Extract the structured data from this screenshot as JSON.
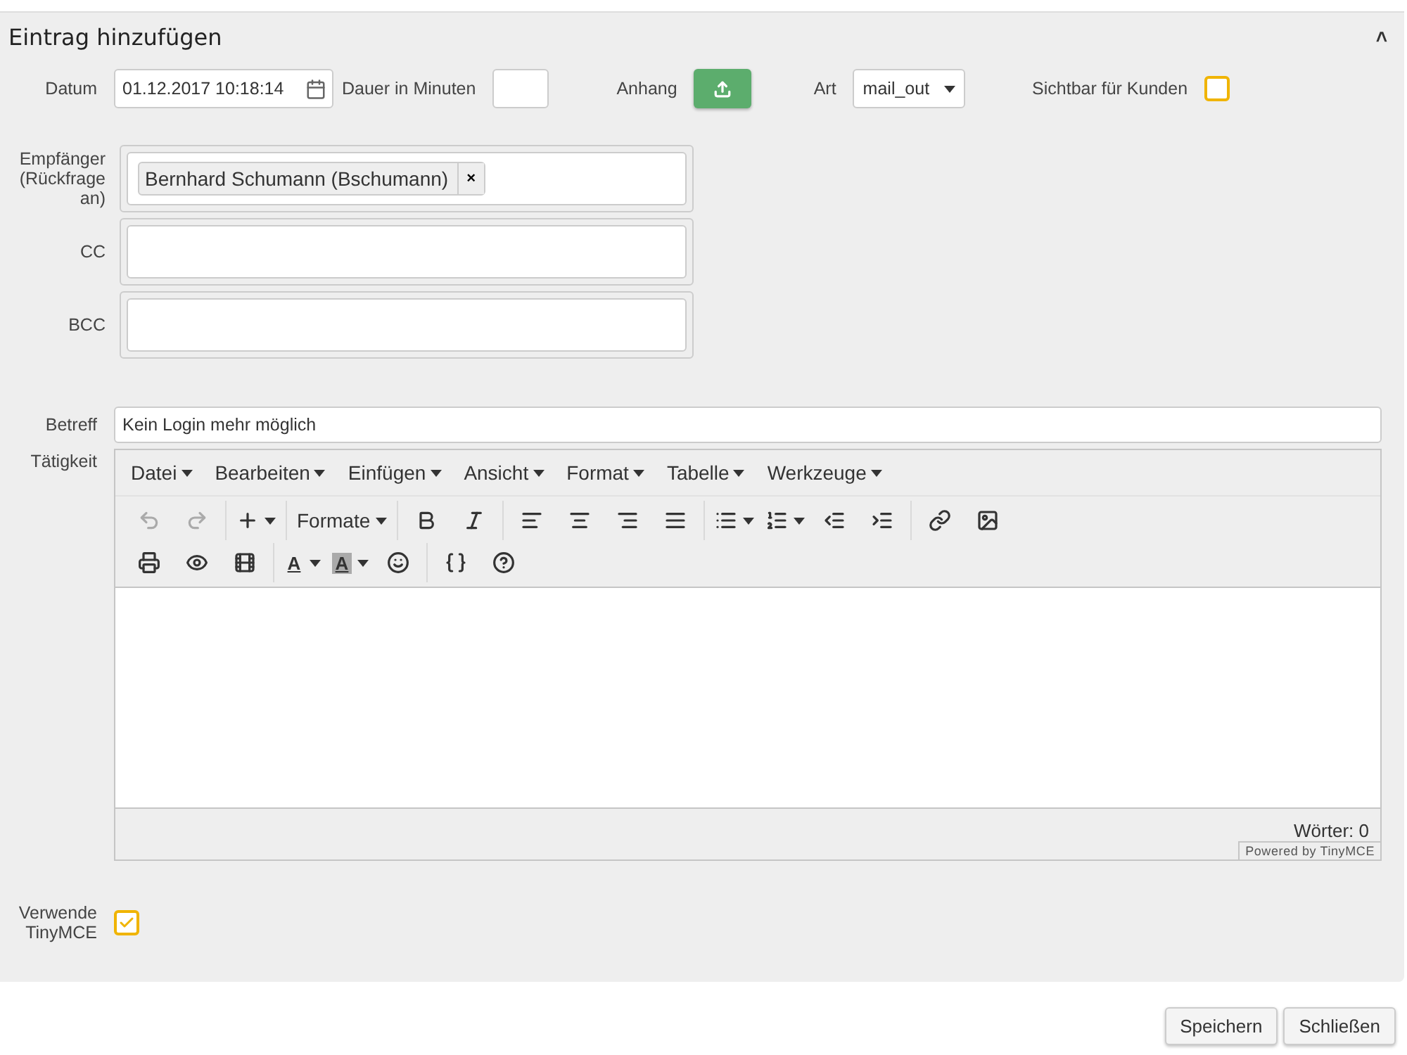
{
  "panel": {
    "title": "Eintrag hinzufügen",
    "collapse_glyph": "˄",
    "expanded": true
  },
  "top_row": {
    "date_label": "Datum",
    "date_value": "01.12.2017 10:18:14",
    "duration_label": "Dauer in Minuten",
    "attachment_label": "Anhang",
    "type_label": "Art",
    "type_value": "mail_out",
    "visible_label": "Sichtbar für Kunden",
    "visible_checked": false
  },
  "recipients": [
    {
      "label": "Empfänger (Rückfrage an)",
      "tags": [
        {
          "text": "Bernhard Schumann (Bschumann)",
          "remove": "×"
        }
      ]
    },
    {
      "label": "CC"
    },
    {
      "label": "BCC"
    }
  ],
  "subject": {
    "label": "Betreff",
    "value": "Kein Login mehr möglich"
  },
  "activity": {
    "label": "Tätigkeit",
    "menu": [
      "Datei",
      "Bearbeiten",
      "Einfügen",
      "Ansicht",
      "Format",
      "Tabelle",
      "Werkzeuge"
    ],
    "undo_disabled": true,
    "redo_disabled": true,
    "formats_label": "Formate",
    "text_color_letter": "A",
    "bg_color_letter": "A",
    "word_count": "Wörter: 0",
    "branding": "Powered by TinyMCE"
  },
  "use_tinymce": {
    "label": "Verwende TinyMCE",
    "checked": true
  },
  "buttons": [
    "Speichern",
    "Schließen"
  ]
}
